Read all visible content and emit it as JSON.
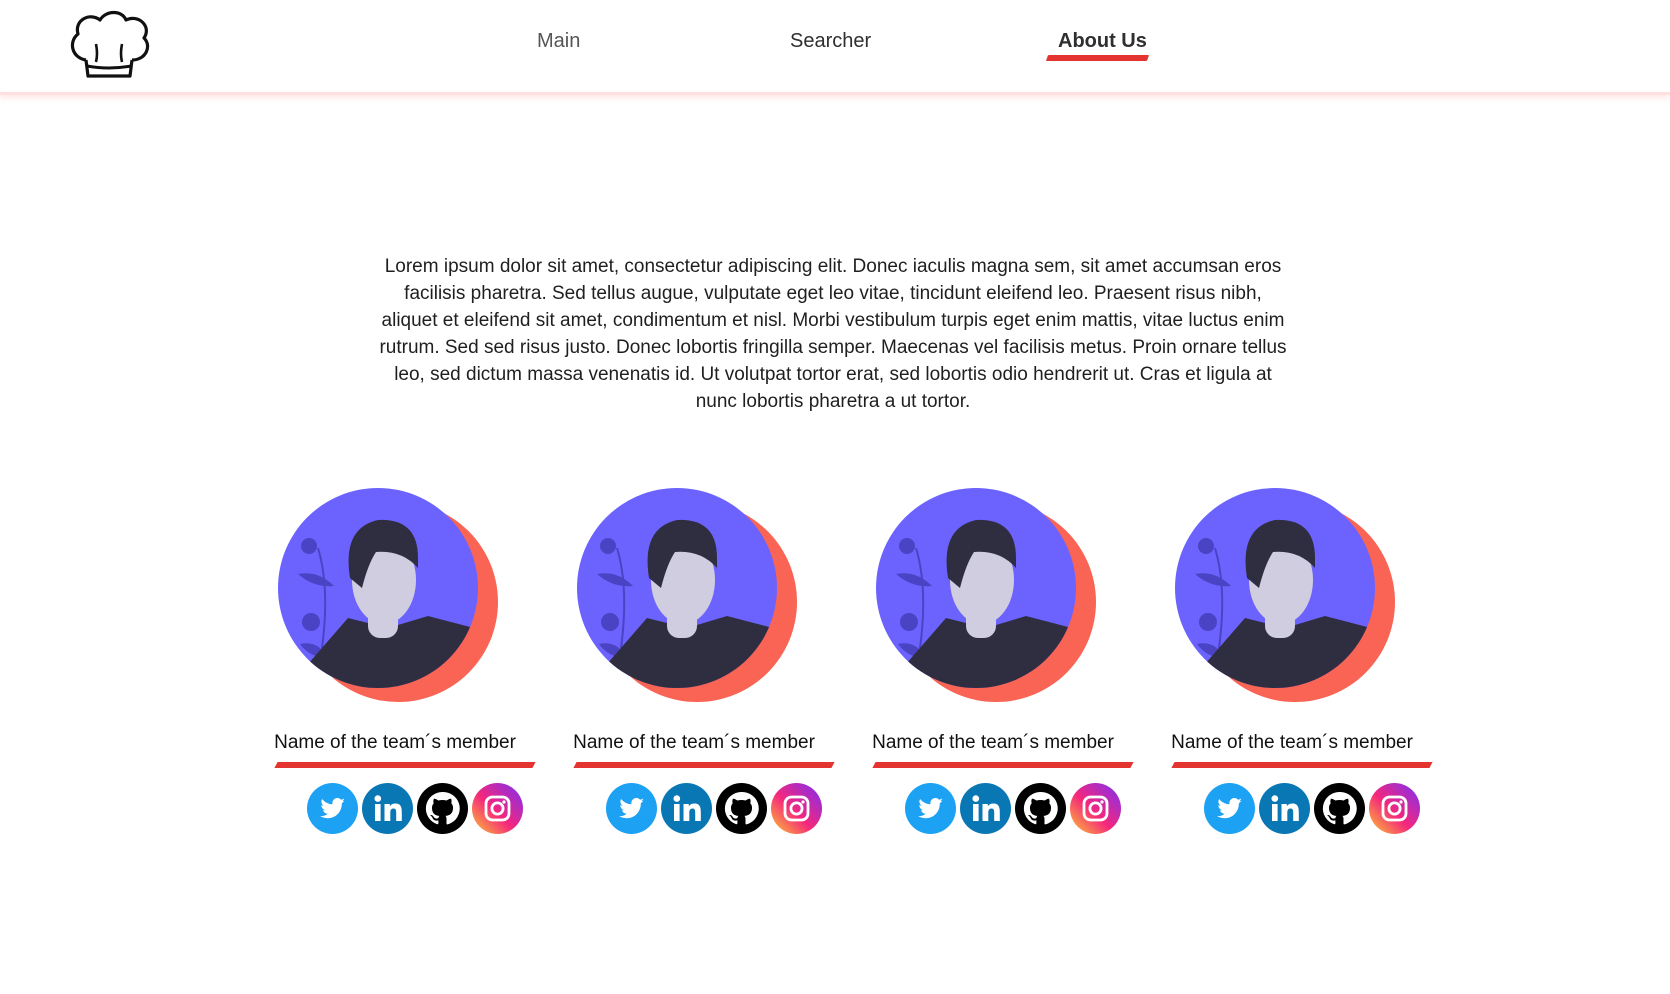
{
  "nav": {
    "items": [
      {
        "label": "Main"
      },
      {
        "label": "Searcher"
      },
      {
        "label": "About Us",
        "active": true
      }
    ],
    "logo_icon": "chef-hat-icon",
    "accent_color": "#e3342f"
  },
  "intro": {
    "text": "Lorem ipsum dolor sit amet, consectetur adipiscing elit. Donec iaculis magna sem, sit amet accumsan eros facilisis pharetra. Sed tellus augue, vulputate eget leo vitae, tincidunt eleifend leo. Praesent risus nibh, aliquet et eleifend sit amet, condimentum et nisl. Morbi vestibulum turpis eget enim mattis, vitae luctus enim rutrum. Sed sed risus justo. Donec lobortis fringilla semper. Maecenas vel facilisis metus. Proin ornare tellus leo, sed dictum massa venenatis id. Ut volutpat tortor erat, sed lobortis odio hendrerit ut. Cras et ligula at nunc lobortis pharetra a ut tortor."
  },
  "team": {
    "members": [
      {
        "name": "Name of the team´s member"
      },
      {
        "name": "Name of the team´s member"
      },
      {
        "name": "Name of the team´s member"
      },
      {
        "name": "Name of the team´s member"
      }
    ],
    "socials": [
      "twitter-icon",
      "linkedin-icon",
      "github-icon",
      "instagram-icon"
    ],
    "colors": {
      "avatar_bg": "#6c63ff",
      "avatar_shadow": "#f96454",
      "twitter": "#1da1f2",
      "linkedin": "#0a77b5",
      "github": "#000000"
    }
  }
}
